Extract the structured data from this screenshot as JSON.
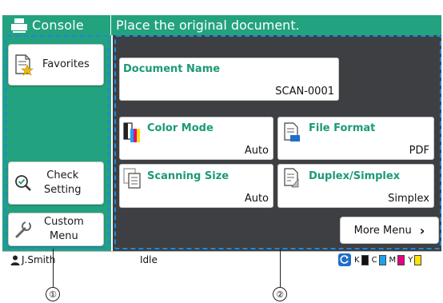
{
  "header": {
    "console_label": "Console",
    "message": "Place the original document."
  },
  "left_menu": {
    "favorites": "Favorites",
    "check_setting": [
      "Check",
      "Setting"
    ],
    "custom_menu": [
      "Custom",
      "Menu"
    ]
  },
  "document_name": {
    "title": "Document Name",
    "value": "SCAN-0001"
  },
  "settings": {
    "color_mode": {
      "title": "Color Mode",
      "value": "Auto"
    },
    "file_format": {
      "title": "File Format",
      "value": "PDF"
    },
    "scanning_size": {
      "title": "Scanning Size",
      "value": "Auto"
    },
    "duplex_simplex": {
      "title": "Duplex/Simplex",
      "value": "Simplex"
    }
  },
  "more_menu": "More Menu",
  "status": {
    "user": "J.Smith",
    "state": "Idle",
    "toner": [
      {
        "label": "K",
        "color": "#111111"
      },
      {
        "label": "C",
        "color": "#1fa2e8"
      },
      {
        "label": "M",
        "color": "#e6007e"
      },
      {
        "label": "Y",
        "color": "#ffe100"
      }
    ]
  },
  "callouts": [
    "①",
    "②"
  ],
  "colors": {
    "header_green": "#23a27f",
    "main_bg": "#3d3f43",
    "selection_blue": "#1e88d8",
    "title_green": "#1b9a76"
  }
}
